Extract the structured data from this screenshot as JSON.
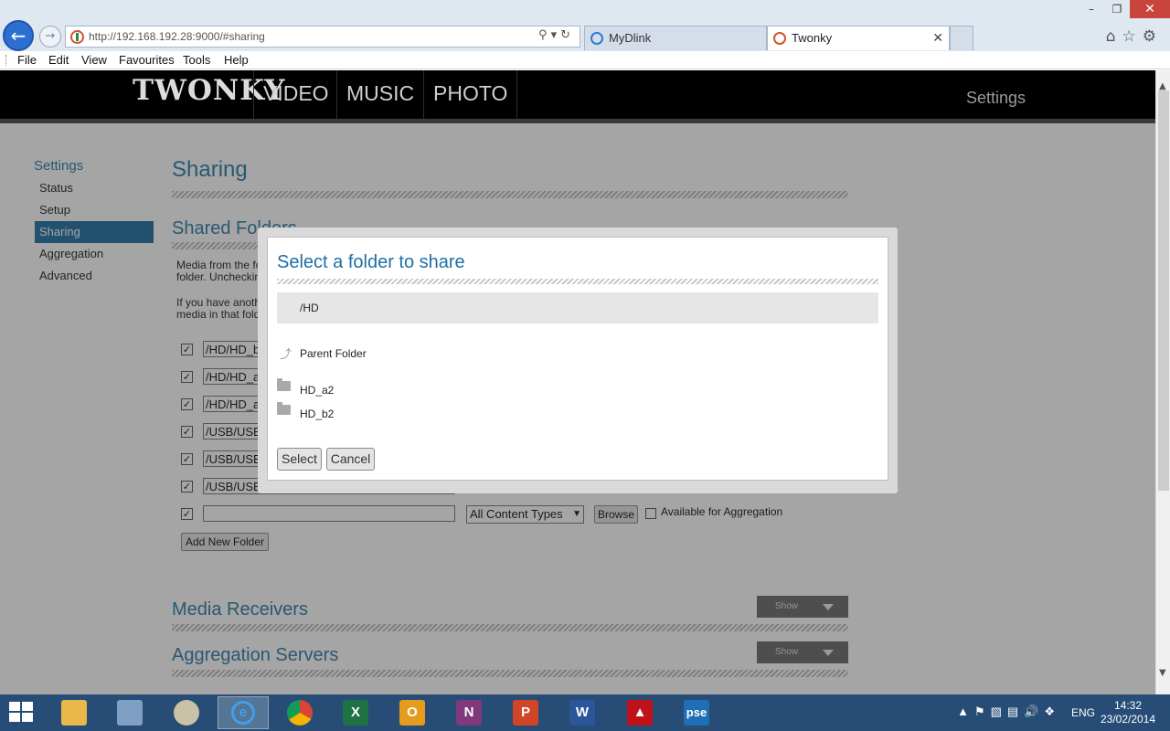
{
  "browser": {
    "url": "http://192.168.192.28:9000/#sharing",
    "tabs": [
      {
        "label": "MyDlink"
      },
      {
        "label": "Twonky"
      }
    ],
    "menu": [
      "File",
      "Edit",
      "View",
      "Favourites",
      "Tools",
      "Help"
    ]
  },
  "twonky": {
    "logo": "TWONKY",
    "nav": [
      "VIDEO",
      "MUSIC",
      "PHOTO"
    ],
    "settings_link": "Settings"
  },
  "sidebar": {
    "title": "Settings",
    "items": [
      {
        "label": "Status"
      },
      {
        "label": "Setup"
      },
      {
        "label": "Sharing",
        "active": true
      },
      {
        "label": "Aggregation"
      },
      {
        "label": "Advanced"
      }
    ]
  },
  "main": {
    "title": "Sharing",
    "shared_folders_title": "Shared Folders",
    "para1_line1": "Media from the fo",
    "para1_line2": "folder. Uncheckin",
    "para2_line1": "If you have anoth",
    "para2_line2": "media in that fold",
    "folders": [
      {
        "path": "/HD/HD_b",
        "checked": true
      },
      {
        "path": "/HD/HD_a",
        "checked": true
      },
      {
        "path": "/HD/HD_a",
        "checked": true
      },
      {
        "path": "/USB/USE",
        "checked": true
      },
      {
        "path": "/USB/USE",
        "checked": true
      },
      {
        "path": "/USB/USE",
        "checked": true
      }
    ],
    "new_row": {
      "checked": true,
      "path": "",
      "content_type": "All Content Types",
      "browse_label": "Browse",
      "aggregation_label": "Available for Aggregation"
    },
    "add_folder_label": "Add New Folder",
    "media_receivers_title": "Media Receivers",
    "aggregation_servers_title": "Aggregation Servers",
    "show_label": "Show"
  },
  "dialog": {
    "title": "Select a folder to share",
    "current_path": "/HD",
    "parent_label": "Parent Folder",
    "folders": [
      "HD_a2",
      "HD_b2"
    ],
    "select_label": "Select",
    "cancel_label": "Cancel"
  },
  "taskbar": {
    "apps": [
      "explorer",
      "calculator",
      "paint",
      "internet-explorer",
      "chrome",
      "excel",
      "outlook",
      "onenote",
      "powerpoint",
      "word",
      "acrobat",
      "pse"
    ],
    "pse_label": "pse",
    "language": "ENG",
    "time": "14:32",
    "date": "23/02/2014"
  }
}
